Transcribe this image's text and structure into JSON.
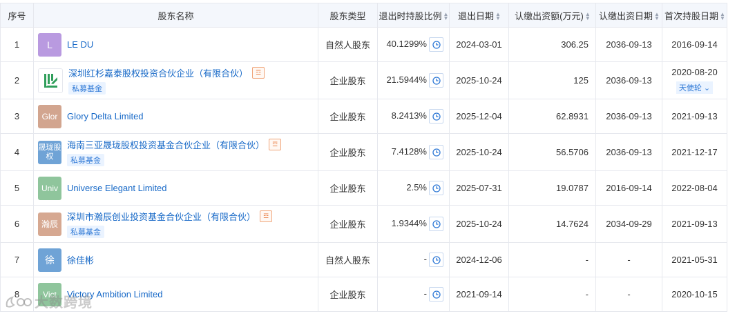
{
  "headers": {
    "seq": "序号",
    "name": "股东名称",
    "type": "股东类型",
    "ratio": "退出时持股比例",
    "exit_date": "退出日期",
    "capital": "认缴出资额(万元)",
    "capital_date": "认缴出资日期",
    "first_date": "首次持股日期"
  },
  "rows": [
    {
      "seq": "1",
      "logo": "L",
      "logo_color": "#b99ae0",
      "name": "LE DU",
      "tag": "",
      "type": "自然人股东",
      "ratio": "40.1299%",
      "exit_date": "2024-03-01",
      "capital": "306.25",
      "capital_date": "2036-09-13",
      "first_date": "2016-09-14",
      "round": ""
    },
    {
      "seq": "2",
      "logo": "",
      "logo_color": "#ffffff",
      "name": "深圳红杉嘉泰股权投资合伙企业（有限合伙）",
      "tag": "私募基金",
      "type": "企业股东",
      "ratio": "21.5944%",
      "exit_date": "2025-10-24",
      "capital": "125",
      "capital_date": "2036-09-13",
      "first_date": "2020-08-20",
      "round": "天使轮"
    },
    {
      "seq": "3",
      "logo": "Glor",
      "logo_color": "#d2a58f",
      "name": "Glory Delta Limited",
      "tag": "",
      "type": "企业股东",
      "ratio": "8.2413%",
      "exit_date": "2025-12-04",
      "capital": "62.8931",
      "capital_date": "2036-09-13",
      "first_date": "2021-09-13",
      "round": ""
    },
    {
      "seq": "4",
      "logo": "晟珑股权",
      "logo_color": "#6fa3d6",
      "name": "海南三亚晟珑股权投资基金合伙企业（有限合伙）",
      "tag": "私募基金",
      "type": "企业股东",
      "ratio": "7.4128%",
      "exit_date": "2025-10-24",
      "capital": "56.5706",
      "capital_date": "2036-09-13",
      "first_date": "2021-12-17",
      "round": ""
    },
    {
      "seq": "5",
      "logo": "Univ",
      "logo_color": "#8fc59c",
      "name": "Universe Elegant Limited",
      "tag": "",
      "type": "企业股东",
      "ratio": "2.5%",
      "exit_date": "2025-07-31",
      "capital": "19.0787",
      "capital_date": "2016-09-14",
      "first_date": "2022-08-04",
      "round": ""
    },
    {
      "seq": "6",
      "logo": "瀚辰",
      "logo_color": "#d6a891",
      "name": "深圳市瀚辰创业投资基金合伙企业（有限合伙）",
      "tag": "私募基金",
      "type": "企业股东",
      "ratio": "1.9344%",
      "exit_date": "2025-10-24",
      "capital": "14.7624",
      "capital_date": "2034-09-29",
      "first_date": "2021-09-13",
      "round": ""
    },
    {
      "seq": "7",
      "logo": "徐",
      "logo_color": "#6fa3d6",
      "name": "徐佳彬",
      "tag": "",
      "type": "自然人股东",
      "ratio": "-",
      "exit_date": "2024-12-06",
      "capital": "-",
      "capital_date": "-",
      "first_date": "2021-05-31",
      "round": ""
    },
    {
      "seq": "8",
      "logo": "Vict",
      "logo_color": "#8fc59c",
      "name": "Victory Ambition Limited",
      "tag": "",
      "type": "企业股东",
      "ratio": "-",
      "exit_date": "2021-09-14",
      "capital": "-",
      "capital_date": "-",
      "first_date": "2020-10-15",
      "round": ""
    }
  ],
  "watermark": "大数跨境",
  "colors": {
    "link": "#1668c7",
    "tag_bg": "#eaf3ff",
    "header_bg": "#f4f7fc"
  }
}
